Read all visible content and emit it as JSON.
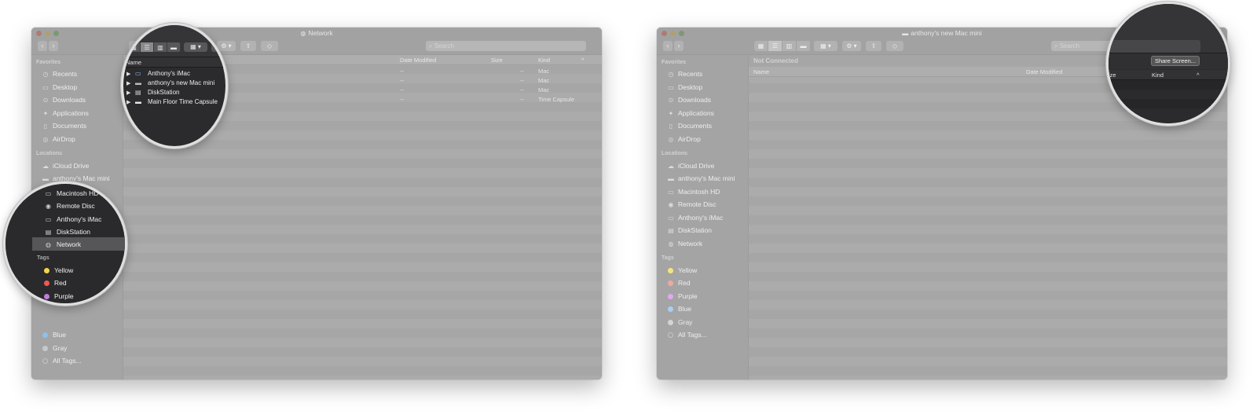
{
  "left_window": {
    "title": "Network",
    "title_icon": "globe-icon",
    "search_placeholder": "Search",
    "sidebar": {
      "favorites_header": "Favorites",
      "favorites": [
        {
          "label": "Recents",
          "icon": "clock-icon"
        },
        {
          "label": "Desktop",
          "icon": "desktop-icon"
        },
        {
          "label": "Downloads",
          "icon": "download-icon"
        },
        {
          "label": "Applications",
          "icon": "applications-icon"
        },
        {
          "label": "Documents",
          "icon": "document-icon"
        },
        {
          "label": "AirDrop",
          "icon": "airdrop-icon"
        }
      ],
      "locations_header": "Locations",
      "locations": [
        {
          "label": "iCloud Drive",
          "icon": "cloud-icon"
        },
        {
          "label": "anthony's Mac mini",
          "icon": "mac-mini-icon"
        },
        {
          "label": "Macintosh HD",
          "icon": "hard-drive-icon"
        },
        {
          "label": "Remote Disc",
          "icon": "disc-icon"
        },
        {
          "label": "Anthony's iMac",
          "icon": "imac-icon"
        },
        {
          "label": "DiskStation",
          "icon": "server-icon"
        },
        {
          "label": "Network",
          "icon": "globe-icon",
          "selected": true
        }
      ],
      "tags_header": "Tags",
      "tags": [
        {
          "label": "Yellow",
          "color": "#f2d34a"
        },
        {
          "label": "Red",
          "color": "#ef5a52"
        },
        {
          "label": "Purple",
          "color": "#c27ae0"
        },
        {
          "label": "Blue",
          "color": "#5aa8f0"
        },
        {
          "label": "Gray",
          "color": "#a0a0a0"
        },
        {
          "label": "All Tags...",
          "color": "transparent"
        }
      ]
    },
    "columns": {
      "name": "Name",
      "date_modified": "Date Modified",
      "size": "Size",
      "kind": "Kind"
    },
    "rows": [
      {
        "name": "Anthony's iMac",
        "date": "--",
        "size": "--",
        "kind": "Mac",
        "icon": "imac-icon"
      },
      {
        "name": "anthony's new Mac mini",
        "date": "--",
        "size": "--",
        "kind": "Mac",
        "icon": "mac-mini-icon"
      },
      {
        "name": "DiskStation",
        "date": "--",
        "size": "--",
        "kind": "Mac",
        "icon": "server-icon"
      },
      {
        "name": "Main Floor Time Capsule",
        "date": "--",
        "size": "--",
        "kind": "Time Capsule",
        "icon": "time-capsule-icon"
      }
    ]
  },
  "right_window": {
    "title": "anthony's new Mac mini",
    "title_icon": "mac-mini-icon",
    "search_placeholder": "Search",
    "status": "Not Connected",
    "share_screen_label": "Share Screen...",
    "columns": {
      "name": "Name",
      "date_modified": "Date Modified",
      "size": "Size",
      "kind": "Kind"
    },
    "sidebar": {
      "favorites_header": "Favorites",
      "favorites": [
        {
          "label": "Recents"
        },
        {
          "label": "Desktop"
        },
        {
          "label": "Downloads"
        },
        {
          "label": "Applications"
        },
        {
          "label": "Documents"
        },
        {
          "label": "AirDrop"
        }
      ],
      "locations_header": "Locations",
      "locations": [
        {
          "label": "iCloud Drive"
        },
        {
          "label": "anthony's Mac mini"
        },
        {
          "label": "Macintosh HD"
        },
        {
          "label": "Remote Disc"
        },
        {
          "label": "Anthony's iMac"
        },
        {
          "label": "DiskStation"
        },
        {
          "label": "Network"
        }
      ],
      "tags_header": "Tags",
      "tags": [
        {
          "label": "Yellow",
          "color": "#f2e67a"
        },
        {
          "label": "Red",
          "color": "#f0a8a4"
        },
        {
          "label": "Purple",
          "color": "#e0a8f0"
        },
        {
          "label": "Blue",
          "color": "#a8cff2"
        },
        {
          "label": "Gray",
          "color": "#d4d4d4"
        },
        {
          "label": "All Tags...",
          "color": "transparent"
        }
      ]
    }
  },
  "kind_sort_glyph": "^"
}
